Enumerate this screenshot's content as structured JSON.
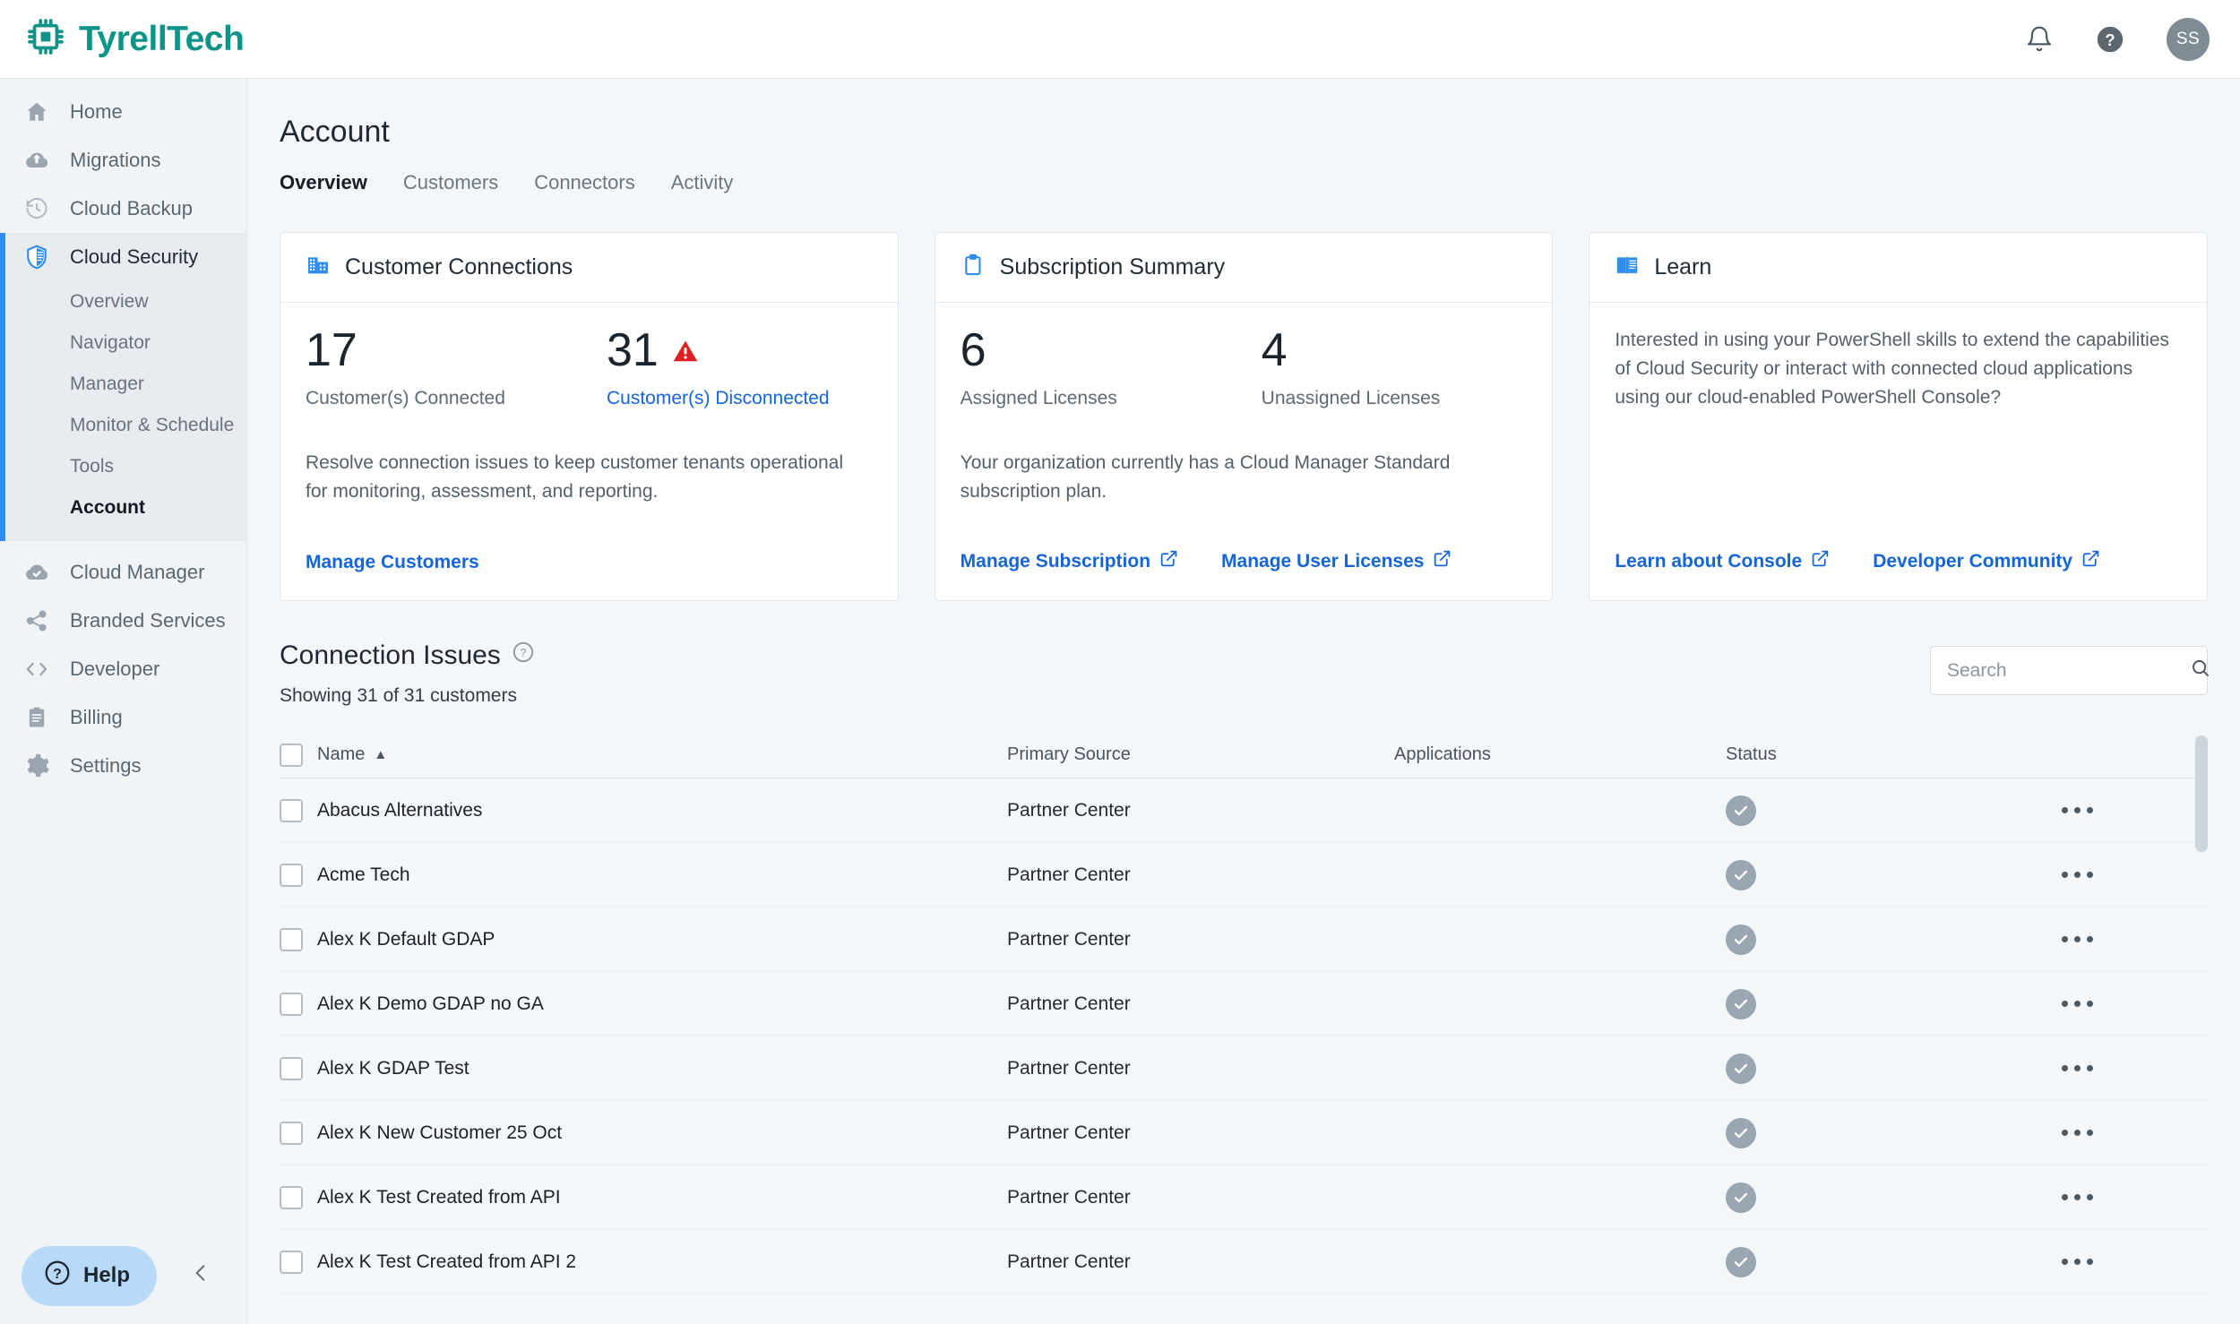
{
  "brand": {
    "name": "TyrellTech",
    "logo_icon": "chip-icon",
    "color": "#0d9488"
  },
  "topbar": {
    "notifications_icon": "bell-icon",
    "help_icon": "help-circle-icon",
    "avatar_initials": "SS"
  },
  "sidebar": {
    "items": [
      {
        "label": "Home",
        "icon": "home-icon"
      },
      {
        "label": "Migrations",
        "icon": "cloud-upload-icon"
      },
      {
        "label": "Cloud Backup",
        "icon": "history-icon"
      }
    ],
    "active_group": {
      "label": "Cloud Security",
      "icon": "shield-icon",
      "sub_items": [
        {
          "label": "Overview",
          "active": false
        },
        {
          "label": "Navigator",
          "active": false
        },
        {
          "label": "Manager",
          "active": false
        },
        {
          "label": "Monitor & Schedule",
          "active": false
        },
        {
          "label": "Tools",
          "active": false
        },
        {
          "label": "Account",
          "active": true
        }
      ]
    },
    "items_after": [
      {
        "label": "Cloud Manager",
        "icon": "cloud-check-icon"
      },
      {
        "label": "Branded Services",
        "icon": "share-icon"
      },
      {
        "label": "Developer",
        "icon": "code-icon"
      },
      {
        "label": "Billing",
        "icon": "clipboard-icon"
      },
      {
        "label": "Settings",
        "icon": "gear-icon"
      }
    ],
    "help_button": {
      "label": "Help",
      "icon": "question-circle-icon"
    },
    "collapse_icon": "chevron-left-icon"
  },
  "page": {
    "title": "Account",
    "tabs": [
      {
        "label": "Overview",
        "active": true
      },
      {
        "label": "Customers",
        "active": false
      },
      {
        "label": "Connectors",
        "active": false
      },
      {
        "label": "Activity",
        "active": false
      }
    ]
  },
  "cards": {
    "customer_connections": {
      "title": "Customer Connections",
      "icon": "office-building-icon",
      "connected_value": "17",
      "connected_label": "Customer(s) Connected",
      "disconnected_value": "31",
      "disconnected_label": "Customer(s) Disconnected",
      "warning_icon": "warning-triangle-icon",
      "warning_color": "#e02020",
      "description": "Resolve connection issues to keep customer tenants operational for monitoring, assessment, and reporting.",
      "link_manage_customers": "Manage Customers"
    },
    "subscription_summary": {
      "title": "Subscription Summary",
      "icon": "clipboard-icon",
      "assigned_value": "6",
      "assigned_label": "Assigned Licenses",
      "unassigned_value": "4",
      "unassigned_label": "Unassigned Licenses",
      "description": "Your organization currently has a Cloud Manager Standard subscription plan.",
      "link_manage_subscription": "Manage Subscription",
      "link_manage_user_licenses": "Manage User Licenses"
    },
    "learn": {
      "title": "Learn",
      "icon": "book-icon",
      "description": "Interested in using your PowerShell skills to extend the capabilities of Cloud Security or interact with connected cloud applications using our cloud-enabled PowerShell Console?",
      "link_learn_about_console": "Learn about Console",
      "link_developer_community": "Developer Community"
    }
  },
  "connection_issues": {
    "title": "Connection Issues",
    "help_icon": "question-circle-icon",
    "showing_text": "Showing 31 of 31 customers",
    "search": {
      "placeholder": "Search",
      "value": "",
      "icon": "search-icon"
    },
    "columns": [
      "Name",
      "Primary Source",
      "Applications",
      "Status"
    ],
    "sort_column": "Name",
    "sort_direction": "ascending",
    "rows": [
      {
        "name": "Abacus Alternatives",
        "primary_source": "Partner Center",
        "applications": "",
        "status": "ok"
      },
      {
        "name": "Acme Tech",
        "primary_source": "Partner Center",
        "applications": "",
        "status": "ok"
      },
      {
        "name": "Alex K Default GDAP",
        "primary_source": "Partner Center",
        "applications": "",
        "status": "ok"
      },
      {
        "name": "Alex K Demo GDAP no GA",
        "primary_source": "Partner Center",
        "applications": "",
        "status": "ok"
      },
      {
        "name": "Alex K GDAP Test",
        "primary_source": "Partner Center",
        "applications": "",
        "status": "ok"
      },
      {
        "name": "Alex K New Customer 25 Oct",
        "primary_source": "Partner Center",
        "applications": "",
        "status": "ok"
      },
      {
        "name": "Alex K Test Created from API",
        "primary_source": "Partner Center",
        "applications": "",
        "status": "ok"
      },
      {
        "name": "Alex K Test Created from API 2",
        "primary_source": "Partner Center",
        "applications": "",
        "status": "ok"
      }
    ],
    "row_action_icon": "ellipsis-icon",
    "status_icon": "check-circle-icon"
  },
  "colors": {
    "brand_teal": "#0d9488",
    "link_blue": "#1565d8",
    "accent_blue": "#2f8cf0",
    "danger_red": "#e02020",
    "sidebar_bg": "#f1f4f7",
    "main_bg": "#f4f7f9"
  }
}
